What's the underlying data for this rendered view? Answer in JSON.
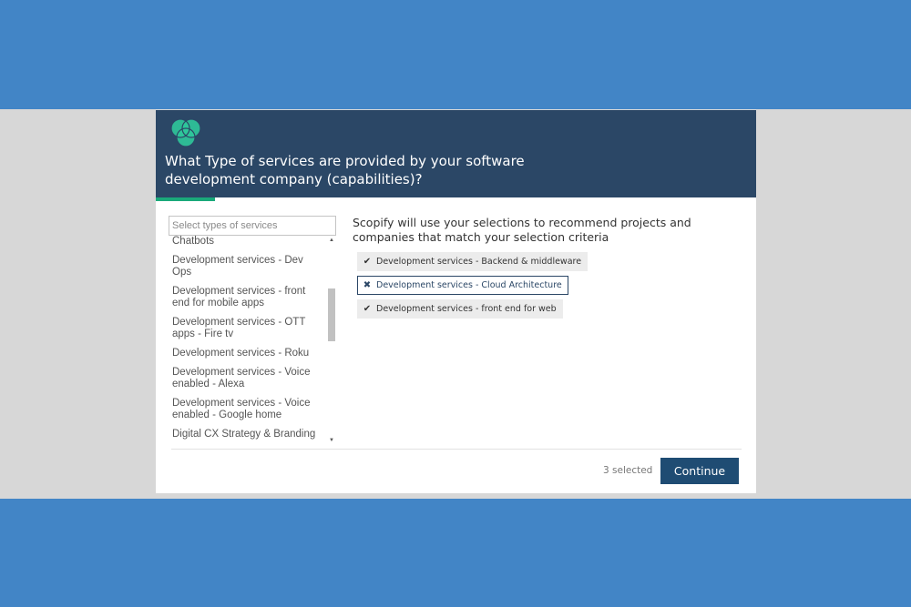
{
  "header": {
    "title": "What Type of services are provided by your software development company (capabilities)?",
    "accent_color": "#1aa97a",
    "bg_color": "#2b4766"
  },
  "search": {
    "placeholder": "Select types of services"
  },
  "services_list": [
    "Chatbots",
    "Development services - Dev Ops",
    "Development services - front end for mobile apps",
    "Development services - OTT apps - Fire tv",
    "Development services - Roku",
    "Development services - Voice enabled - Alexa",
    "Development services - Voice enabled - Google home",
    "Digital CX Strategy & Branding"
  ],
  "info": {
    "text": "Scopify will use your selections to recommend projects and companies that match your selection criteria"
  },
  "selected": [
    {
      "label": "Development services - Backend & middleware",
      "icon": "check-icon",
      "state": "selected"
    },
    {
      "label": "Development services - Cloud Architecture",
      "icon": "remove-icon",
      "state": "hover"
    },
    {
      "label": "Development services - front end for web",
      "icon": "check-icon",
      "state": "selected"
    }
  ],
  "footer": {
    "count_label": "3 selected",
    "continue_label": "Continue"
  }
}
